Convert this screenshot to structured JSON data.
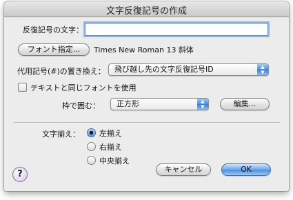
{
  "dialog": {
    "title": "文字反復記号の作成"
  },
  "repeat_char": {
    "label": "反復記号の文字：",
    "value": ""
  },
  "font": {
    "button_label": "フォント指定...",
    "current_font": "Times New Roman 13 斜体"
  },
  "substitute": {
    "label": "代用記号(#)の置き換え：",
    "selected": "飛び越し先の文字反復記号ID"
  },
  "same_font_checkbox": {
    "label": "テキストと同じフォントを使用",
    "checked": false
  },
  "enclosure": {
    "label": "枠で囲む：",
    "selected": "正方形",
    "edit_button": "編集..."
  },
  "alignment": {
    "label": "文字揃え：",
    "options": [
      "左揃え",
      "右揃え",
      "中央揃え"
    ],
    "selected": "左揃え"
  },
  "actions": {
    "cancel": "キャンセル",
    "ok": "OK",
    "help": "?"
  },
  "colors": {
    "accent": "#4d8ee0",
    "window_bg": "#ececec"
  }
}
